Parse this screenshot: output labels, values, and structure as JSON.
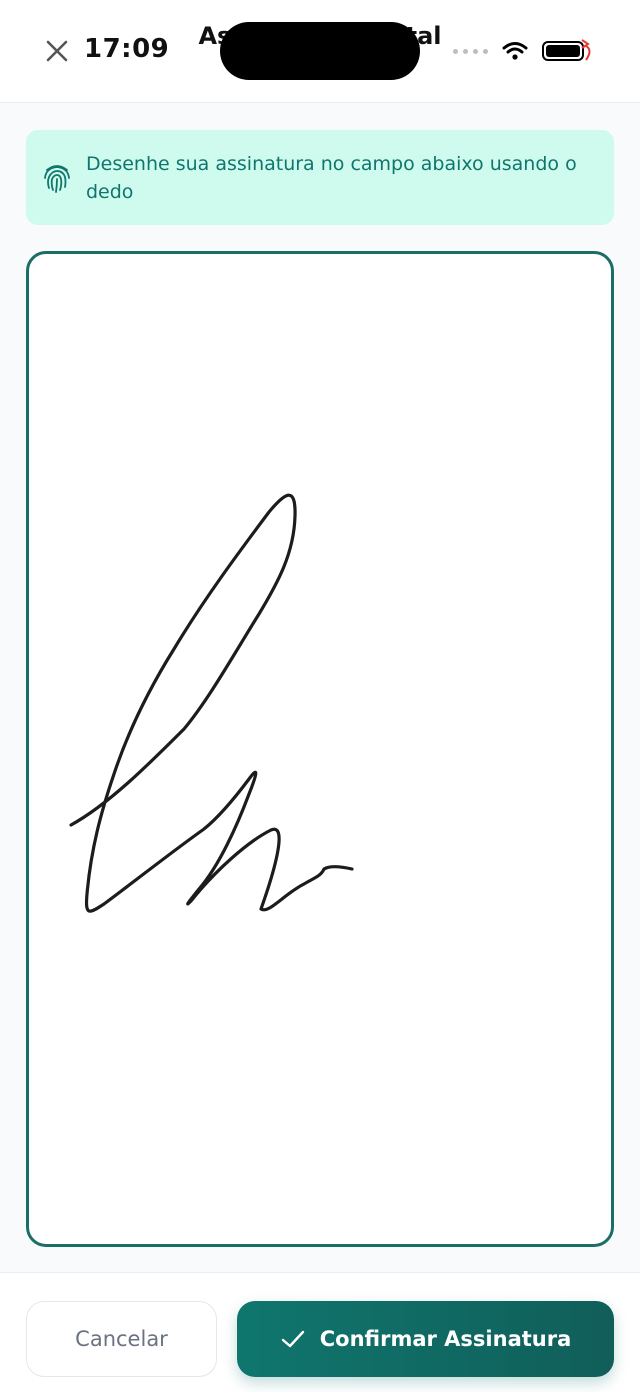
{
  "status_bar": {
    "time": "17:09"
  },
  "header": {
    "title": "Assinatura Digital",
    "subtitle": ""
  },
  "notice": {
    "text": "Desenhe sua assinatura no campo abaixo usando o dedo"
  },
  "buttons": {
    "cancel_label": "Cancelar",
    "confirm_label": "Confirmar Assinatura"
  },
  "icons": {
    "close": "close-icon",
    "wifi": "wifi-icon",
    "battery": "battery-icon",
    "fingerprint": "fingerprint-icon",
    "check": "check-icon"
  },
  "colors": {
    "accent": "#0f766e",
    "notice_bg": "#cffbee",
    "border": "#1b6e66"
  }
}
